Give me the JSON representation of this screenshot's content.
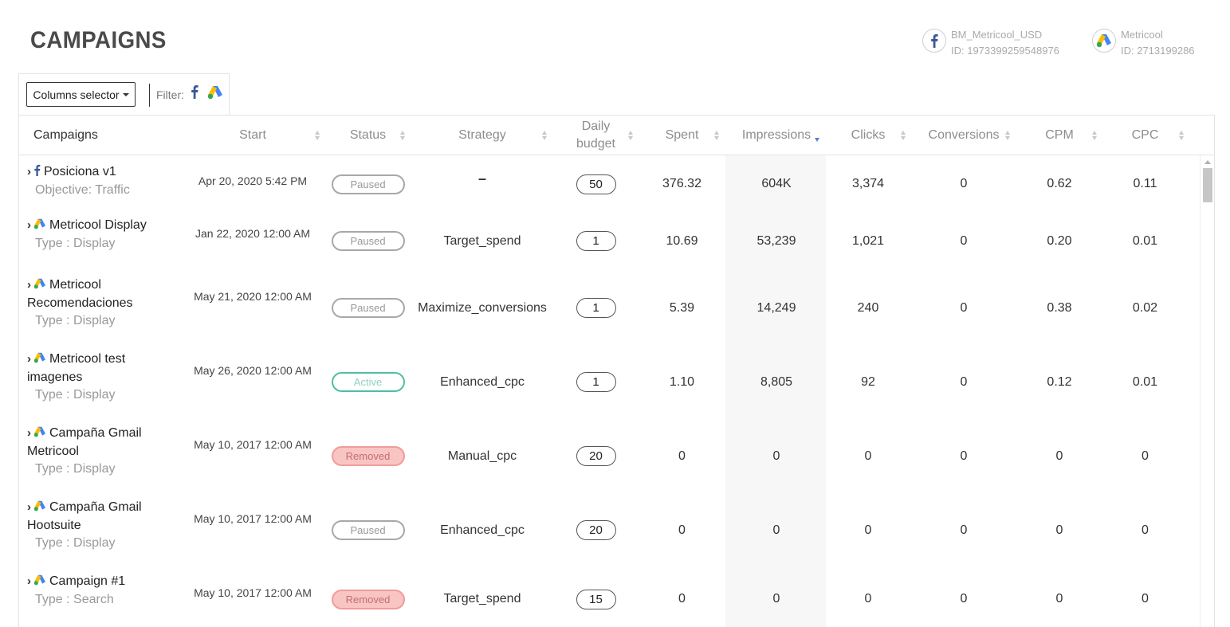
{
  "page": {
    "title": "CAMPAIGNS"
  },
  "accounts": [
    {
      "name": "BM_Metricool_USD",
      "id": "ID: 1973399259548976",
      "icon": "facebook-icon"
    },
    {
      "name": "Metricool",
      "id": "ID: 2713199286",
      "icon": "google-ads-icon"
    }
  ],
  "toolbar": {
    "columns_selector": "Columns selector",
    "filter_label": "Filter:"
  },
  "table": {
    "headers": {
      "campaigns": "Campaigns",
      "start": "Start",
      "status": "Status",
      "strategy": "Strategy",
      "daily_budget_1": "Daily",
      "daily_budget_2": "budget",
      "spent": "Spent",
      "impressions": "Impressions",
      "clicks": "Clicks",
      "conversions": "Conversions",
      "cpm": "CPM",
      "cpc": "CPC"
    },
    "sorted_by": "Impressions",
    "sort_direction": "descending",
    "rows": [
      {
        "platform": "facebook-icon",
        "name_1": "Posiciona v1",
        "name_2": "",
        "sub": "Objective: Traffic",
        "start": "Apr 20, 2020 5:42 PM",
        "status": "Paused",
        "strategy": "–",
        "budget": "50",
        "spent": "376.32",
        "impressions": "604K",
        "clicks": "3,374",
        "conversions": "0",
        "cpm": "0.62",
        "cpc": "0.11"
      },
      {
        "platform": "google-ads-icon",
        "name_1": "Metricool Display",
        "name_2": "",
        "sub": "Type : Display",
        "start": "Jan 22, 2020 12:00 AM",
        "status": "Paused",
        "strategy": "Target_spend",
        "budget": "1",
        "spent": "10.69",
        "impressions": "53,239",
        "clicks": "1,021",
        "conversions": "0",
        "cpm": "0.20",
        "cpc": "0.01"
      },
      {
        "platform": "google-ads-icon",
        "name_1": "Metricool",
        "name_2": "Recomendaciones",
        "sub": "Type : Display",
        "start": "May 21, 2020 12:00 AM",
        "status": "Paused",
        "strategy": "Maximize_conversions",
        "budget": "1",
        "spent": "5.39",
        "impressions": "14,249",
        "clicks": "240",
        "conversions": "0",
        "cpm": "0.38",
        "cpc": "0.02"
      },
      {
        "platform": "google-ads-icon",
        "name_1": "Metricool test",
        "name_2": "imagenes",
        "sub": "Type : Display",
        "start": "May 26, 2020 12:00 AM",
        "status": "Active",
        "strategy": "Enhanced_cpc",
        "budget": "1",
        "spent": "1.10",
        "impressions": "8,805",
        "clicks": "92",
        "conversions": "0",
        "cpm": "0.12",
        "cpc": "0.01"
      },
      {
        "platform": "google-ads-icon",
        "name_1": "Campaña Gmail",
        "name_2": "Metricool",
        "sub": "Type : Display",
        "start": "May 10, 2017 12:00 AM",
        "status": "Removed",
        "strategy": "Manual_cpc",
        "budget": "20",
        "spent": "0",
        "impressions": "0",
        "clicks": "0",
        "conversions": "0",
        "cpm": "0",
        "cpc": "0"
      },
      {
        "platform": "google-ads-icon",
        "name_1": "Campaña Gmail",
        "name_2": "Hootsuite",
        "sub": "Type : Display",
        "start": "May 10, 2017 12:00 AM",
        "status": "Paused",
        "strategy": "Enhanced_cpc",
        "budget": "20",
        "spent": "0",
        "impressions": "0",
        "clicks": "0",
        "conversions": "0",
        "cpm": "0",
        "cpc": "0"
      },
      {
        "platform": "google-ads-icon",
        "name_1": "Campaign #1",
        "name_2": "",
        "sub": "Type : Search",
        "start": "May 10, 2017 12:00 AM",
        "status": "Removed",
        "strategy": "Target_spend",
        "budget": "15",
        "spent": "0",
        "impressions": "0",
        "clicks": "0",
        "conversions": "0",
        "cpm": "0",
        "cpc": "0"
      }
    ]
  },
  "colors": {
    "facebook": "#3b5998",
    "gads_blue": "#4285f4",
    "gads_yellow": "#fbbc04",
    "gads_green": "#34a853",
    "active": "#4dbfa3",
    "removed": "#f9c4c4",
    "sort_active": "#5b7bd5"
  }
}
